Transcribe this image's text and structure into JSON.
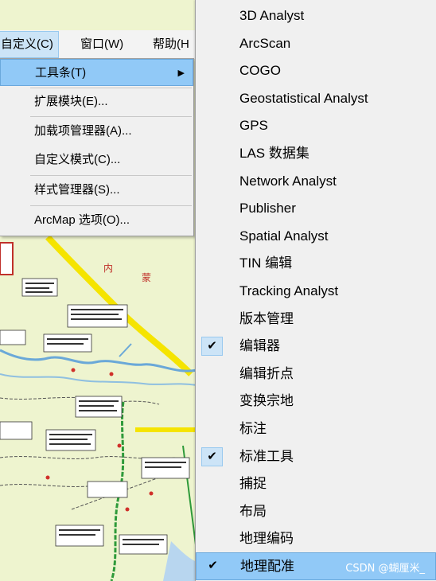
{
  "menubar": {
    "items": [
      {
        "label": "自定义(C)"
      },
      {
        "label": "窗口(W)"
      },
      {
        "label": "帮助(H"
      }
    ]
  },
  "customize_menu": {
    "items": [
      {
        "label": "工具条(T)",
        "submenu_arrow": "▶"
      },
      {
        "label": "扩展模块(E)..."
      },
      {
        "label": "加载项管理器(A)..."
      },
      {
        "label": "自定义模式(C)..."
      },
      {
        "label": "样式管理器(S)..."
      },
      {
        "label": "ArcMap 选项(O)..."
      }
    ]
  },
  "toolbars_menu": {
    "checkmark": "✔",
    "items": [
      {
        "label": "3D Analyst",
        "checked": false
      },
      {
        "label": "ArcScan",
        "checked": false
      },
      {
        "label": "COGO",
        "checked": false
      },
      {
        "label": "Geostatistical Analyst",
        "checked": false
      },
      {
        "label": "GPS",
        "checked": false
      },
      {
        "label": "LAS 数据集",
        "checked": false
      },
      {
        "label": "Network Analyst",
        "checked": false
      },
      {
        "label": "Publisher",
        "checked": false
      },
      {
        "label": "Spatial Analyst",
        "checked": false
      },
      {
        "label": "TIN 编辑",
        "checked": false
      },
      {
        "label": "Tracking Analyst",
        "checked": false
      },
      {
        "label": "版本管理",
        "checked": false
      },
      {
        "label": "编辑器",
        "checked": true
      },
      {
        "label": "编辑折点",
        "checked": false
      },
      {
        "label": "变换宗地",
        "checked": false
      },
      {
        "label": "标注",
        "checked": false
      },
      {
        "label": "标准工具",
        "checked": true
      },
      {
        "label": "捕捉",
        "checked": false
      },
      {
        "label": "布局",
        "checked": false
      },
      {
        "label": "地理编码",
        "checked": false
      },
      {
        "label": "地理配准",
        "checked": true,
        "highlighted": true
      }
    ]
  },
  "map": {
    "labels": [
      "内",
      "蒙"
    ]
  },
  "watermark": "CSDN @蝴厘米_",
  "colors": {
    "menu_bg": "#f0f0f0",
    "highlight": "#91c9f7",
    "check_bg": "#cce4f7",
    "map_bg": "#eef4cf",
    "road_yellow": "#f5e400",
    "river_blue": "#6aa8d8",
    "route_green": "#2e9a3a"
  }
}
